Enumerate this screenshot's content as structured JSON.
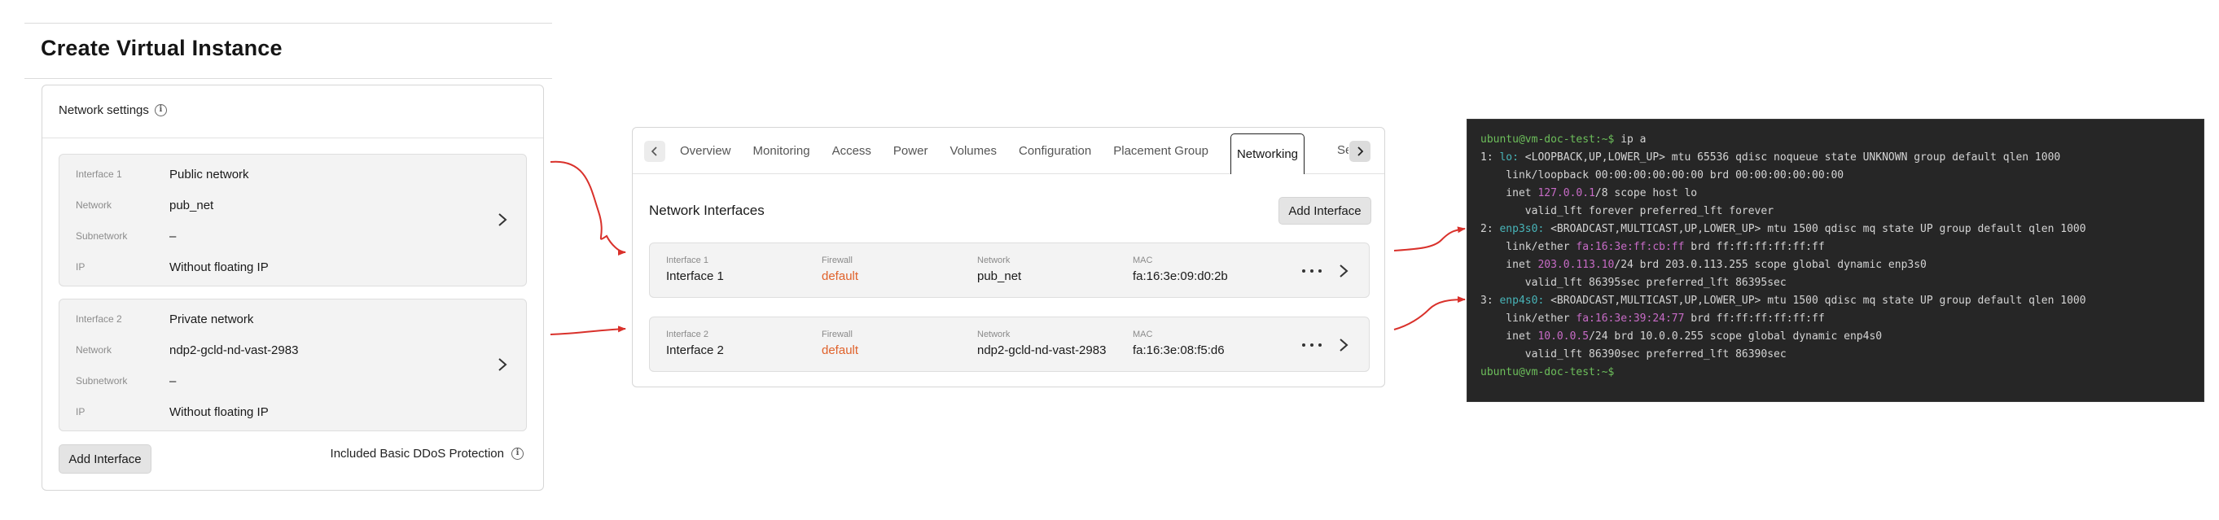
{
  "left": {
    "page_title": "Create Virtual Instance",
    "network_settings_title": "Network settings",
    "interfaces": [
      {
        "rows": [
          {
            "key": "Interface 1",
            "value": "Public network"
          },
          {
            "key": "Network",
            "value": "pub_net"
          },
          {
            "key": "Subnetwork",
            "value": "–"
          },
          {
            "key": "IP",
            "value": "Without floating IP"
          }
        ]
      },
      {
        "rows": [
          {
            "key": "Interface 2",
            "value": "Private network"
          },
          {
            "key": "Network",
            "value": "ndp2-gcld-nd-vast-2983"
          },
          {
            "key": "Subnetwork",
            "value": "–"
          },
          {
            "key": "IP",
            "value": "Without floating IP"
          }
        ]
      }
    ],
    "add_interface_label": "Add Interface",
    "ddos_label": "Included Basic DDoS Protection"
  },
  "middle": {
    "tabs": [
      "Overview",
      "Monitoring",
      "Access",
      "Power",
      "Volumes",
      "Configuration",
      "Placement Group",
      "Networking"
    ],
    "active_tab": "Networking",
    "clipped_tab": "Se",
    "heading": "Network Interfaces",
    "add_interface_label": "Add Interface",
    "rows": [
      {
        "interface_key": "Interface 1",
        "interface_val": "Interface 1",
        "firewall_key": "Firewall",
        "firewall_val": "default",
        "network_key": "Network",
        "network_val": "pub_net",
        "mac_key": "MAC",
        "mac_val": "fa:16:3e:09:d0:2b"
      },
      {
        "interface_key": "Interface 2",
        "interface_val": "Interface 2",
        "firewall_key": "Firewall",
        "firewall_val": "default",
        "network_key": "Network",
        "network_val": "ndp2-gcld-nd-vast-2983",
        "mac_key": "MAC",
        "mac_val": "fa:16:3e:08:f5:d6"
      }
    ],
    "firewall_color": "#e0622b"
  },
  "terminal": {
    "prompt": "ubuntu@vm-doc-test:~$",
    "command": " ip a",
    "line1_num": "1: ",
    "line1_if": "lo:",
    "line1_rest": " <LOOPBACK,UP,LOWER_UP> mtu 65536 qdisc noqueue state UNKNOWN group default qlen 1000",
    "line2": "    link/loopback 00:00:00:00:00:00 brd 00:00:00:00:00:00",
    "line3_pre": "    inet ",
    "line3_ip": "127.0.0.1",
    "line3_rest": "/8 scope host lo",
    "line4": "       valid_lft forever preferred_lft forever",
    "line5_num": "2: ",
    "line5_if": "enp3s0:",
    "line5_rest": " <BROADCAST,MULTICAST,UP,LOWER_UP> mtu 1500 qdisc mq state UP group default qlen 1000",
    "line6_pre": "    link/ether ",
    "line6_mac": "fa:16:3e:ff:cb:ff",
    "line6_rest": " brd ff:ff:ff:ff:ff:ff",
    "line7_pre": "    inet ",
    "line7_ip": "203.0.113.10",
    "line7_rest": "/24 brd 203.0.113.255 scope global dynamic enp3s0",
    "line8": "       valid_lft 86395sec preferred_lft 86395sec",
    "line9_num": "3: ",
    "line9_if": "enp4s0:",
    "line9_rest": " <BROADCAST,MULTICAST,UP,LOWER_UP> mtu 1500 qdisc mq state UP group default qlen 1000",
    "line10_pre": "    link/ether ",
    "line10_mac": "fa:16:3e:39:24:77",
    "line10_rest": " brd ff:ff:ff:ff:ff:ff",
    "line11_pre": "    inet ",
    "line11_ip": "10.0.0.5",
    "line11_rest": "/24 brd 10.0.0.255 scope global dynamic enp4s0",
    "line12": "       valid_lft 86390sec preferred_lft 86390sec",
    "prompt_end": "ubuntu@vm-doc-test:~$"
  },
  "colors": {
    "arrow": "#d9312b",
    "terminal_bg": "#262626",
    "prompt_green": "#6dbf5b",
    "iface_cyan": "#48b4b8",
    "addr_magenta": "#c76bc6"
  }
}
